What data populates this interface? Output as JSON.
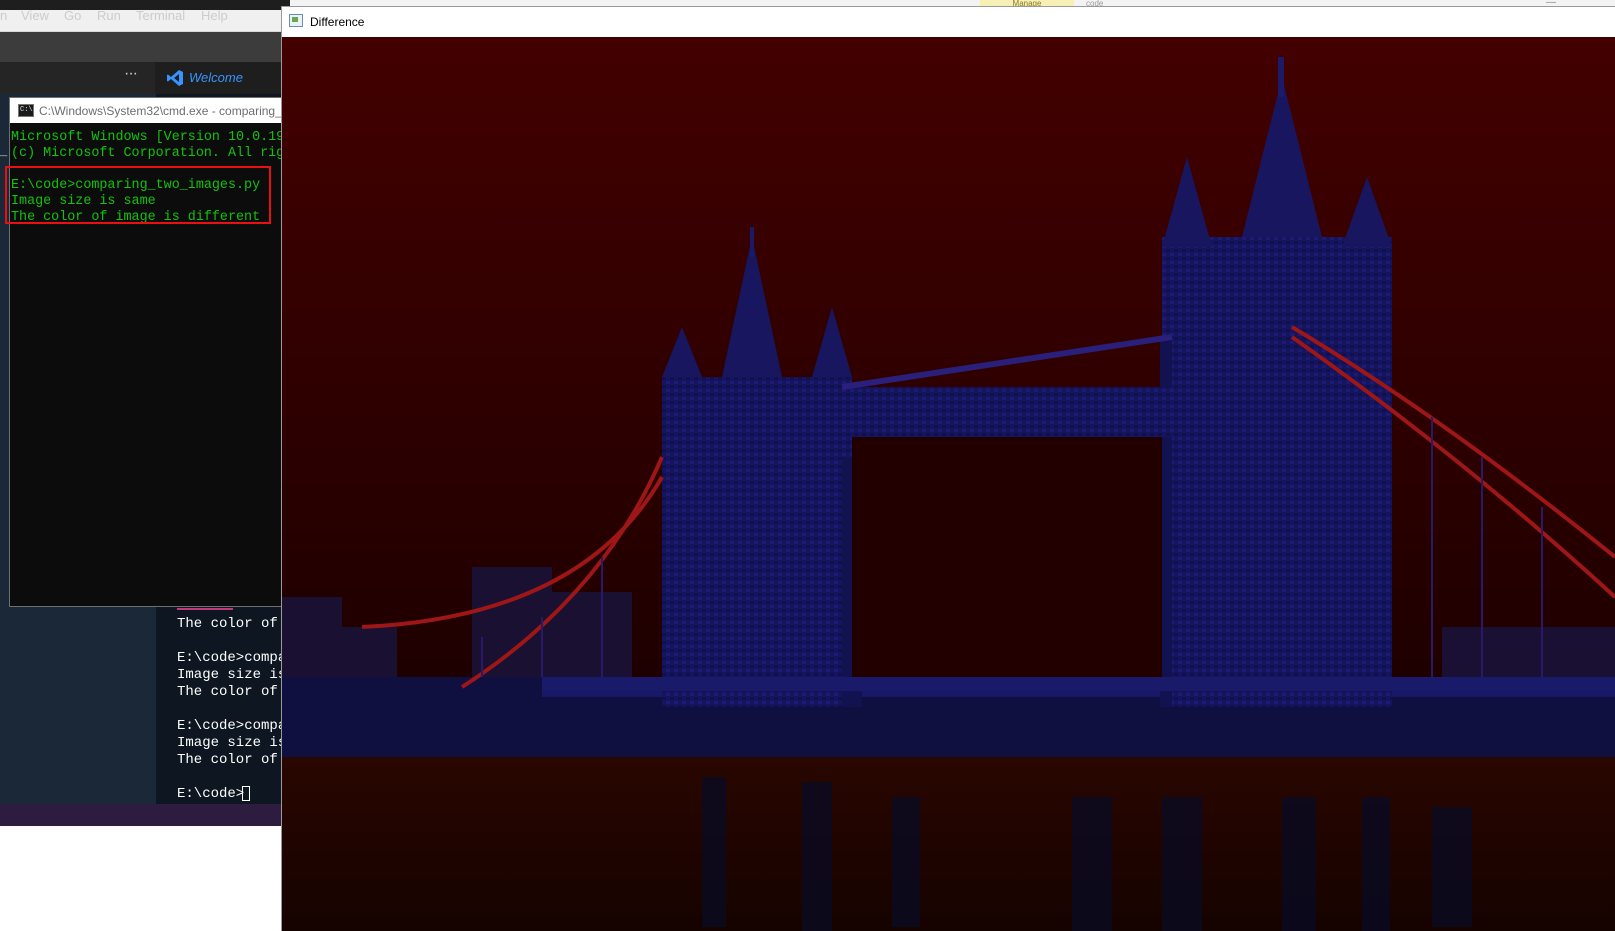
{
  "taskbar_fragments": {
    "manage": "Manage",
    "code": "code"
  },
  "vscode": {
    "menu": [
      "n",
      "View",
      "Go",
      "Run",
      "Terminal",
      "Help"
    ],
    "more_icon": "more-icon",
    "welcome_tab": "Welcome",
    "terminal_lines": [
      "The color of",
      "",
      "E:\\code>compa",
      "Image size is",
      "The color of",
      "",
      "E:\\code>compa",
      "Image size is",
      "The color of",
      "",
      "E:\\code>"
    ],
    "colors": {
      "menubar": "#3c3c3c",
      "statusbar": "#2e1c40",
      "welcome": "#3794ff"
    }
  },
  "cmd": {
    "title": "C:\\Windows\\System32\\cmd.exe - comparing_",
    "icon_text": "C:\\",
    "lines": [
      "Microsoft Windows [Version 10.0.19",
      "(c) Microsoft Corporation. All rig",
      "",
      "E:\\code>comparing_two_images.py",
      "Image size is same",
      "The color of image is different"
    ],
    "edge_mark": "_",
    "colors": {
      "text": "#13c10e",
      "highlight": "#e81010"
    }
  },
  "difference_window": {
    "title": "Difference",
    "minimize": "—",
    "colors": {
      "sky": "#3a0000",
      "bridge": "#14135a",
      "cables": "#a01818",
      "water": "#1c0500"
    }
  }
}
